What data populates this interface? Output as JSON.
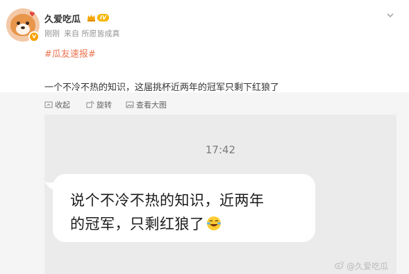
{
  "author": {
    "name": "久爱吃瓜",
    "level": "IV",
    "verified_mark": "v",
    "avatar_icon": "shiba-dog-avatar-icon"
  },
  "meta": {
    "time": "刚刚",
    "source": "来自 所愿皆成真"
  },
  "post": {
    "hashtag": "#瓜友速报#",
    "text": "一个不冷不热的知识，这届挑杯近两年的冠军只剩下红狼了"
  },
  "toolbar": {
    "collect_label": "收起",
    "rotate_label": "旋转",
    "view_label": "查看大图"
  },
  "image": {
    "timestamp": "17:42",
    "bubble_line1": "说个不冷不热的知识，近两年",
    "bubble_line2": "的冠军，只剩红狼了",
    "emoji_icon": "laughing-crying-emoji-icon",
    "watermark": "@久爱吃瓜"
  },
  "colors": {
    "hashtag": "#eb7350",
    "level_badge": "#f7b500",
    "verified": "#f7a000"
  }
}
